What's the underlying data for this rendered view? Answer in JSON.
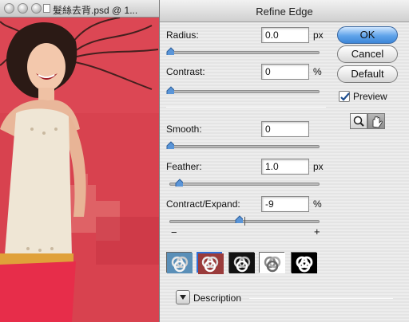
{
  "document_window": {
    "title": "髮絲去背.psd @ 1..."
  },
  "dialog": {
    "title": "Refine Edge",
    "controls": [
      {
        "label": "Radius:",
        "value": "0.0",
        "unit": "px",
        "slider_level": 0.0
      },
      {
        "label": "Contrast:",
        "value": "0",
        "unit": "%",
        "slider_level": 0.0
      },
      {
        "label": "Smooth:",
        "value": "0",
        "unit": "",
        "slider_level": 0.0
      },
      {
        "label": "Feather:",
        "value": "1.0",
        "unit": "px",
        "slider_level": 0.04
      },
      {
        "label": "Contract/Expand:",
        "value": "-9",
        "unit": "%",
        "slider_level": 0.455
      }
    ],
    "expand_scale": {
      "minus": "−",
      "plus": "+"
    },
    "buttons": {
      "ok": "OK",
      "cancel": "Cancel",
      "default": "Default"
    },
    "preview": {
      "label": "Preview",
      "checked": true
    },
    "tools": [
      {
        "icon": "zoom-icon"
      },
      {
        "icon": "hand-icon"
      }
    ],
    "preview_modes": [
      {
        "icon": "standard-mode-icon",
        "selected": false
      },
      {
        "icon": "quick-mask-mode-icon",
        "selected": true
      },
      {
        "icon": "on-black-mode-icon",
        "selected": false
      },
      {
        "icon": "on-white-mode-icon",
        "selected": false
      },
      {
        "icon": "mask-mode-icon",
        "selected": false
      }
    ],
    "description_label": "Description",
    "colors": {
      "accent": "#3d86d8",
      "overlay_red": "#d94452"
    }
  }
}
